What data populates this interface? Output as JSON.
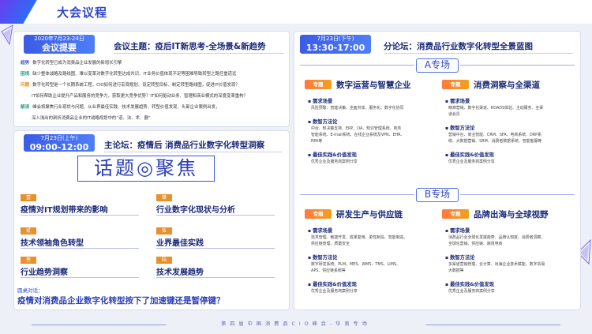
{
  "page_title": "大会议程",
  "main_forum": {
    "date": "2020年7月23-24日",
    "time_label": "会议提要",
    "theme": "会议主题：疫后IT新思考-全场景&新趋势"
  },
  "summary": [
    {
      "tag": "趋势",
      "text": "数字化转型已成为消费品企业发展的新增长引擎",
      "color": "#3b56d6"
    },
    {
      "tag": "困境",
      "text": "缺少整体战略及路线图、难以变革对数字化转型达成共识、IT业务价值体现不足等困难导致转型之路任重道远",
      "color": "#2b9e8e"
    },
    {
      "tag": "问题",
      "text": "数字化转型是一个长期系统工程，CIO如何进行宏观规划、设定转型目标、制定转型路线图，促进IT价值发现？",
      "color": "#e7902c"
    },
    {
      "tag": "",
      "text": "IT如何帮助企业提升产品和服务的竞争力，获取更大竞争优势？IT如何驱动业务、管理和商业模式的深度变革重构？",
      "color": "#333333"
    },
    {
      "tag": "解读",
      "text": "峰会将聚焦行业现状与问题、从业界最佳实践、技术发展趋势、转型价值发现、头部企业案例出发，",
      "color": "#2b9e8e"
    },
    {
      "tag": "",
      "text": "深入浅出的剖析消费品企业的IT战略规划中的“道、法、术、器”",
      "color": "#333333"
    }
  ],
  "forum_main": {
    "date": "7月23日(上午)",
    "time": "09:00-12:00",
    "title": "主论坛：疫情后 消费品行业数字化转型洞察",
    "topic_banner": "话题◎聚焦",
    "topics": [
      {
        "num": "壹",
        "label": "疫情对IT规划带来的影响"
      },
      {
        "num": "肆",
        "label": "行业数字化现状与分析"
      },
      {
        "num": "贰",
        "label": "技术领袖角色转型"
      },
      {
        "num": "伍",
        "label": "业界最佳实践"
      },
      {
        "num": "叁",
        "label": "行业趋势洞察"
      },
      {
        "num": "陆",
        "label": "技术发展趋势"
      }
    ],
    "roundtable_label": "圆桌对话：",
    "roundtable_q": "疫情对消费品企业数字化转型按下了加速键还是暂停键？"
  },
  "forum_sub": {
    "date": "7月23日(下午)",
    "time": "13:30-17:00",
    "title": "分论坛：消费品行业数字化转型全景蓝图",
    "zone_a": "A专场",
    "zone_b": "B专场",
    "tag_label": "专题",
    "blocks": [
      {
        "head": "数字运营与智慧企业",
        "scene_h": "需求场景",
        "scene_t": "风险预警、智能决策、全面共享、服务化、数字化协同",
        "method_h": "数智方法论",
        "method_t": [
          "中台、BI决策支持、ERP、OA、知识管理系统、商务",
          "智能系统、E-mail系统、在线企业系统及VPN、EHR、",
          "RPA等"
        ],
        "best_h": "最佳实践&价值发现",
        "best_t": "优秀企业及服务商案例分享"
      },
      {
        "head": "消费洞察与全渠道",
        "scene_h": "需求场景",
        "scene_t": [
          "精准营销、数字化渠道、ROADS体验、主动服务、全渠",
          "道会员"
        ],
        "method_h": "数智方法论",
        "method_t": [
          "营销中台、商业智能、CRM、SFA、电商系统、DRP系",
          "统、大数据营销、SRM、消费者数据系统、智能客服等"
        ],
        "best_h": "最佳实践&价值发现",
        "best_t": "优秀企业及服务商案例分享"
      },
      {
        "head": "研发生产与供应链",
        "scene_h": "需求场景",
        "scene_t": [
          "需求管理、敏捷开发、成果复用、柔性制造、智能制造、",
          "供应链管理、质量安全"
        ],
        "method_h": "数智方法论",
        "method_t": [
          "数字研发系统、PLM、MES、WMS、TMS、LIMS、",
          "APS、供应链系统等"
        ],
        "best_h": "最佳实践&价值发现",
        "best_t": "优秀企业及服务商案例分享"
      },
      {
        "head": "品牌出海与全球视野",
        "scene_h": "需求场景",
        "scene_t": [
          "消费品行业全球化发展趋势、品牌认知度、消费者洞察、",
          "全球化营销、供应链、跨境电商"
        ],
        "method_h": "数智方法论",
        "method_t": [
          "多渠道营销管理、云计算、出海企业技术赋能、数字贸易",
          "大数据等"
        ],
        "best_h": "最佳实践&价值发现",
        "best_t": "优秀企业及服务商案例分享"
      }
    ]
  },
  "footer": "第四届中国消费品CIO峰会-华南专场"
}
